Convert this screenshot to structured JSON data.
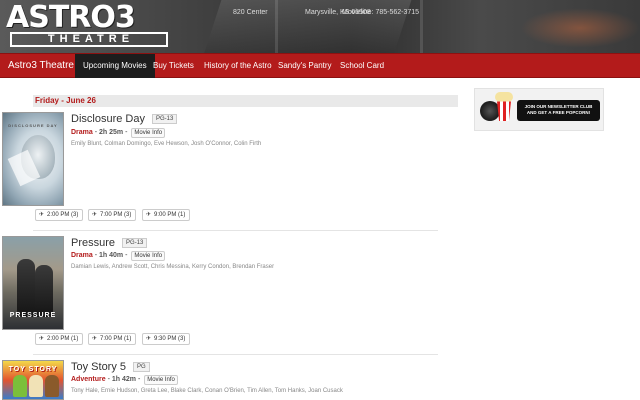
{
  "header": {
    "logo_top": "ASTRO3",
    "logo_bottom": "THEATRE",
    "address": "820 Center",
    "city": "Marysville, KS 66508",
    "phone": "Movieline: 785-562-3715"
  },
  "nav": {
    "brand": "Astro3 Theatre",
    "items": [
      {
        "label": "Upcoming Movies",
        "active": true
      },
      {
        "label": "Buy Tickets"
      },
      {
        "label": "History of the Astro"
      },
      {
        "label": "Sandy's Pantry"
      },
      {
        "label": "School Card"
      }
    ]
  },
  "schedule": {
    "date": "Friday - June 26",
    "movies": [
      {
        "title": "Disclosure Day",
        "rating": "PG-13",
        "genre": "Drama",
        "runtime": "2h 25m",
        "info_label": "Movie Info",
        "cast": "Emily Blunt, Colman Domingo, Eve Hewson, Josh O'Connor, Colin Firth",
        "poster_text": "DISCLOSURE DAY",
        "showtimes": [
          "2:00 PM (3)",
          "7:00 PM (3)",
          "9:00 PM (1)"
        ]
      },
      {
        "title": "Pressure",
        "rating": "PG-13",
        "genre": "Drama",
        "runtime": "1h 40m",
        "info_label": "Movie Info",
        "cast": "Damian Lewis, Andrew Scott, Chris Messina, Kerry Condon, Brendan Fraser",
        "poster_text": "PRESSURE",
        "showtimes": [
          "2:00 PM (1)",
          "7:00 PM (1)",
          "9:30 PM (3)"
        ]
      },
      {
        "title": "Toy Story 5",
        "rating": "PG",
        "genre": "Adventure",
        "runtime": "1h 42m",
        "info_label": "Movie Info",
        "cast": "Tony Hale, Ernie Hudson, Greta Lee, Blake Clark, Conan O'Brien, Tim Allen, Tom Hanks, Joan Cusack",
        "poster_text": "TOY STORY"
      }
    ]
  },
  "sidebar": {
    "newsletter_text": "JOIN OUR NEWSLETTER CLUB AND GET A FREE POPCORN!"
  },
  "icons": {
    "ticket": "ticket-icon",
    "film_reel": "film-reel-icon",
    "popcorn": "popcorn-icon"
  },
  "colors": {
    "brand_red": "#b31b1b",
    "active_nav": "#1d1d1d",
    "date_bar": "#e9e9e9"
  }
}
